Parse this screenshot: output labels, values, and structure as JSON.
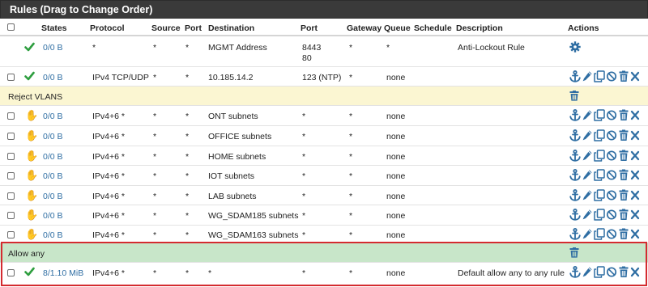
{
  "panel": {
    "title": "Rules (Drag to Change Order)"
  },
  "columns": {
    "states": "States",
    "protocol": "Protocol",
    "source": "Source",
    "port": "Port",
    "destination": "Destination",
    "dport": "Port",
    "gateway": "Gateway",
    "queue": "Queue",
    "schedule": "Schedule",
    "description": "Description",
    "actions": "Actions"
  },
  "rules": [
    {
      "states": "0/0 B",
      "protocol": "*",
      "source": "*",
      "port": "*",
      "destination": "MGMT Address",
      "dport_line1": "8443",
      "dport_line2": "80",
      "gateway": "*",
      "queue": "*",
      "description": "Anti-Lockout Rule"
    },
    {
      "states": "0/0 B",
      "protocol": "IPv4 TCP/UDP",
      "source": "*",
      "port": "*",
      "destination": "10.185.14.2",
      "dport": "123 (NTP)",
      "gateway": "*",
      "queue": "none",
      "description": ""
    },
    {
      "states": "0/0 B",
      "protocol": "IPv4+6 *",
      "source": "*",
      "port": "*",
      "destination": "ONT subnets",
      "dport": "*",
      "gateway": "*",
      "queue": "none",
      "description": ""
    },
    {
      "states": "0/0 B",
      "protocol": "IPv4+6 *",
      "source": "*",
      "port": "*",
      "destination": "OFFICE subnets",
      "dport": "*",
      "gateway": "*",
      "queue": "none",
      "description": ""
    },
    {
      "states": "0/0 B",
      "protocol": "IPv4+6 *",
      "source": "*",
      "port": "*",
      "destination": "HOME subnets",
      "dport": "*",
      "gateway": "*",
      "queue": "none",
      "description": ""
    },
    {
      "states": "0/0 B",
      "protocol": "IPv4+6 *",
      "source": "*",
      "port": "*",
      "destination": "IOT subnets",
      "dport": "*",
      "gateway": "*",
      "queue": "none",
      "description": ""
    },
    {
      "states": "0/0 B",
      "protocol": "IPv4+6 *",
      "source": "*",
      "port": "*",
      "destination": "LAB subnets",
      "dport": "*",
      "gateway": "*",
      "queue": "none",
      "description": ""
    },
    {
      "states": "0/0 B",
      "protocol": "IPv4+6 *",
      "source": "*",
      "port": "*",
      "destination": "WG_SDAM185 subnets",
      "dport": "*",
      "gateway": "*",
      "queue": "none",
      "description": ""
    },
    {
      "states": "0/0 B",
      "protocol": "IPv4+6 *",
      "source": "*",
      "port": "*",
      "destination": "WG_SDAM163 subnets",
      "dport": "*",
      "gateway": "*",
      "queue": "none",
      "description": ""
    },
    {
      "states": "8/1.10 MiB",
      "protocol": "IPv4+6 *",
      "source": "*",
      "port": "*",
      "destination": "*",
      "dport": "*",
      "gateway": "*",
      "queue": "none",
      "description": "Default allow any to any rule"
    }
  ],
  "separators": {
    "reject": "Reject VLANS",
    "allow": "Allow any"
  },
  "colors": {
    "pass": "#2e9e3f",
    "block": "#f0b429",
    "action_blue": "#2f6ea3",
    "separator_yellow": "#fbf6d2",
    "separator_green": "#c8e6c9",
    "highlight_border": "#d42b30"
  },
  "icons": [
    "check-icon",
    "hand-icon",
    "anchor-icon",
    "pencil-icon",
    "copy-icon",
    "disable-icon",
    "trash-icon",
    "delete-x-icon",
    "gear-icon"
  ]
}
